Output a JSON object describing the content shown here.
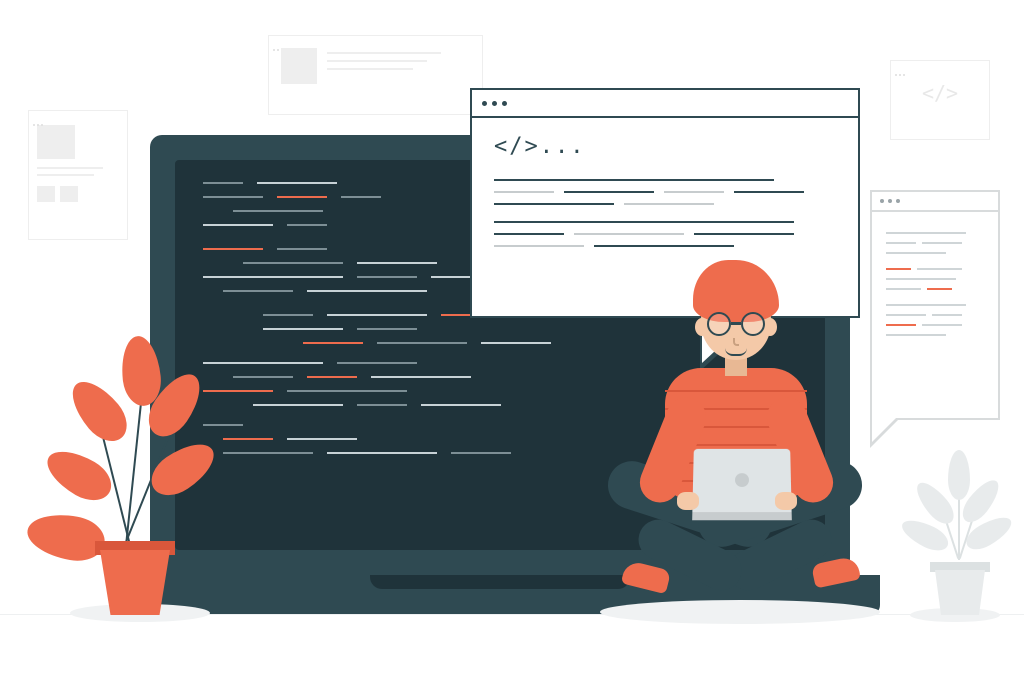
{
  "illustration": {
    "description": "Flat-style illustration of a developer sitting cross-legged with a small laptop in front of a large laptop showing code, with speech-bubble code windows, wireframe cards, and plants.",
    "code_tag_text": "</>...",
    "palette": {
      "dark_teal": "#2f4a52",
      "screen": "#1f333a",
      "orange": "#ee6c4d",
      "orange_dark": "#d9573b",
      "skin": "#f4c9a8",
      "light_gray": "#e8ebec"
    }
  }
}
